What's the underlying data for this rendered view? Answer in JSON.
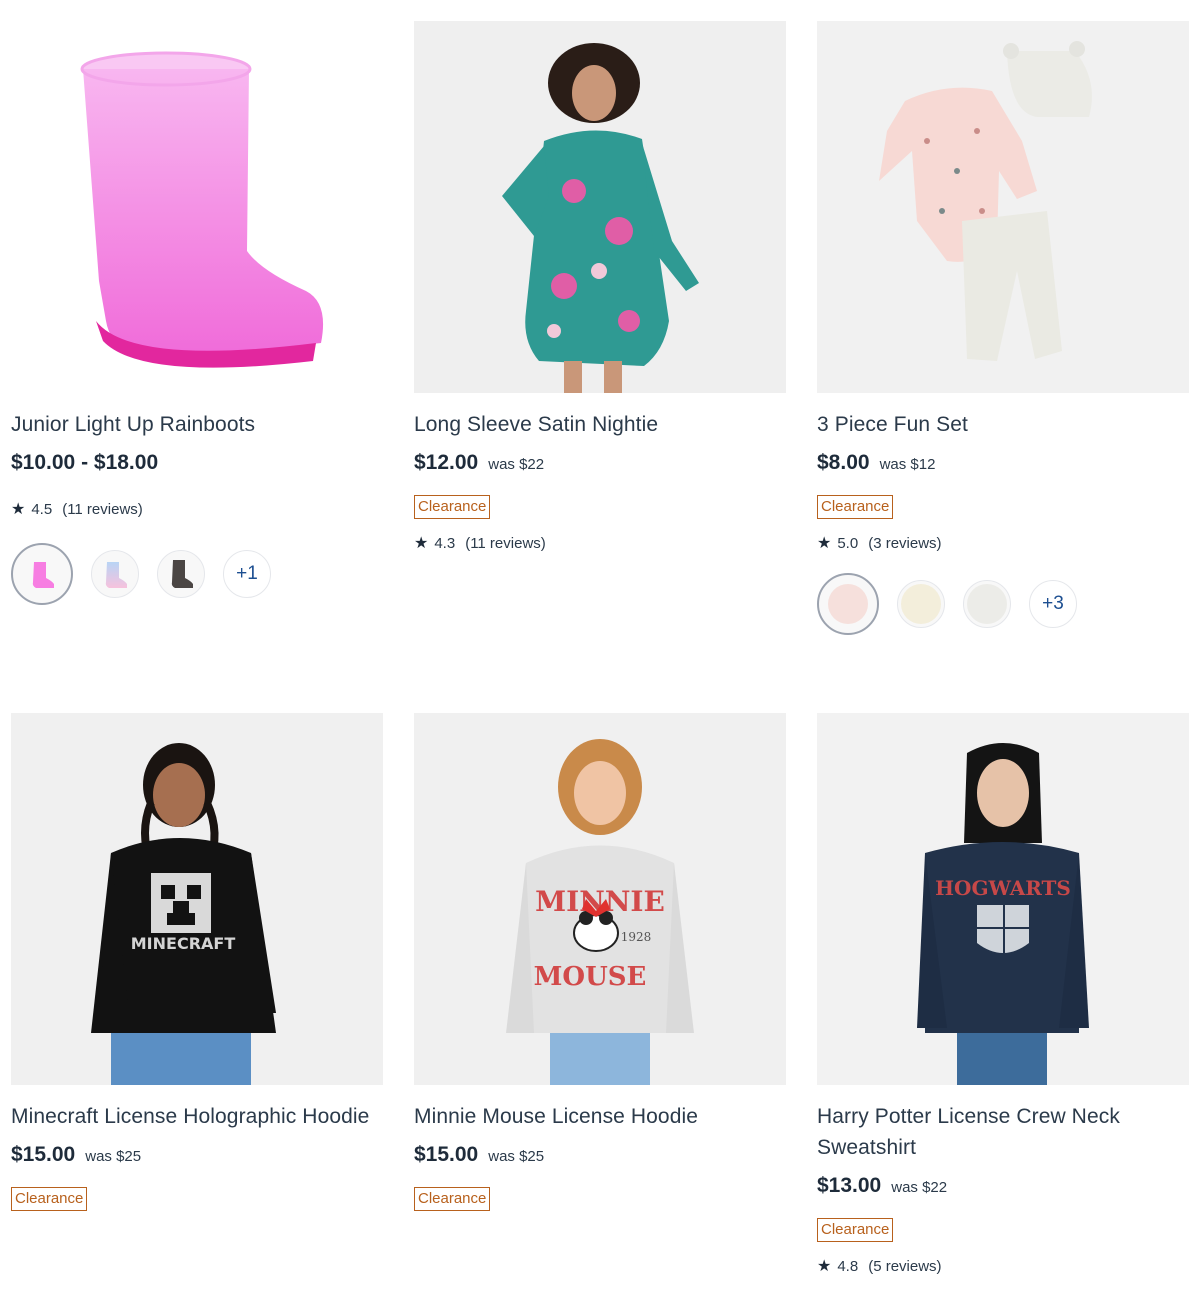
{
  "products": [
    {
      "title": "Junior Light Up Rainboots",
      "price": "$10.00 - $18.00",
      "was": "",
      "badge": "",
      "rating": "4.5",
      "reviews": "(11 reviews)",
      "more_label": "+1",
      "image_icon": "pink-rainboot-image"
    },
    {
      "title": "Long Sleeve Satin Nightie",
      "price": "$12.00",
      "was": "was $22",
      "badge": "Clearance",
      "rating": "4.3",
      "reviews": "(11 reviews)",
      "image_icon": "floral-satin-nightie-image"
    },
    {
      "title": "3 Piece Fun Set",
      "price": "$8.00",
      "was": "was $12",
      "badge": "Clearance",
      "rating": "5.0",
      "reviews": "(3 reviews)",
      "more_label": "+3",
      "image_icon": "baby-three-piece-set-image"
    },
    {
      "title": "Minecraft License Holographic Hoodie",
      "price": "$15.00",
      "was": "was $25",
      "badge": "Clearance",
      "image_icon": "minecraft-hoodie-image",
      "print_text": "MINECRAFT"
    },
    {
      "title": "Minnie Mouse License Hoodie",
      "price": "$15.00",
      "was": "was $25",
      "badge": "Clearance",
      "image_icon": "minnie-mouse-hoodie-image",
      "print_text_top": "MINNIE",
      "print_text_bottom": "MOUSE",
      "print_year": "1928"
    },
    {
      "title": "Harry Potter License Crew Neck Sweatshirt",
      "price": "$13.00",
      "was": "was $22",
      "badge": "Clearance",
      "rating": "4.8",
      "reviews": "(5 reviews)",
      "image_icon": "hogwarts-sweatshirt-image",
      "print_text": "HOGWARTS"
    }
  ],
  "colors": {
    "clearance": "#b8611d",
    "price": "#1e2b3a",
    "more_swatch": "#1d4f91",
    "image_bg": "#f4f4f5"
  }
}
